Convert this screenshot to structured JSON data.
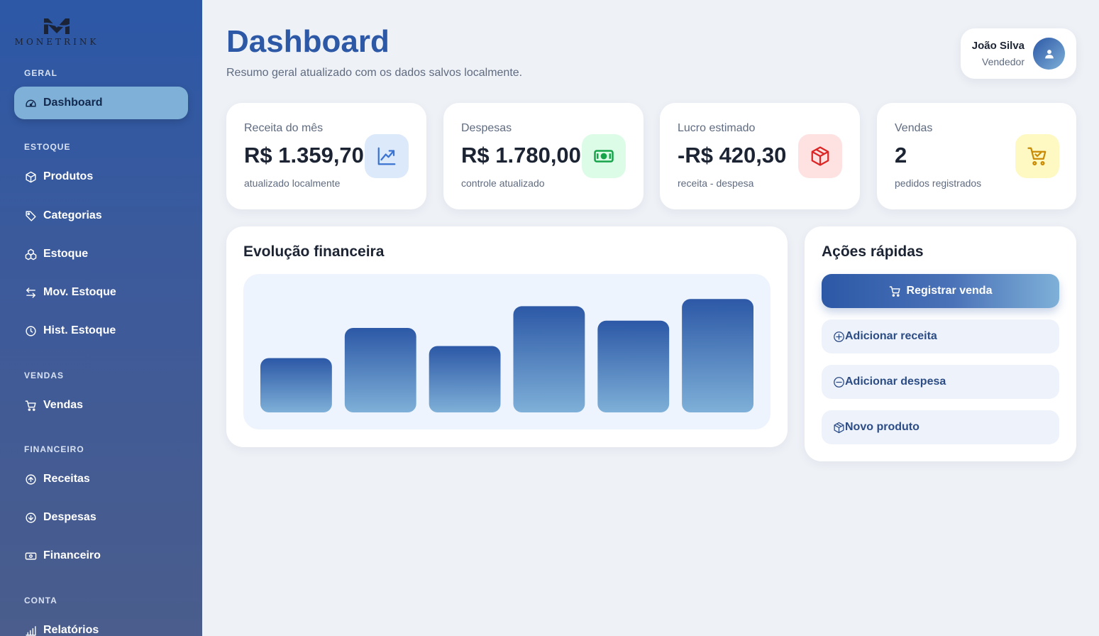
{
  "brand": {
    "name": "MONETRINK"
  },
  "sidebar": {
    "sections": {
      "geral": "GERAL",
      "estoque": "ESTOQUE",
      "vendas": "VENDAS",
      "financeiro": "FINANCEIRO",
      "conta": "CONTA"
    },
    "items": {
      "dashboard": {
        "label": "Dashboard",
        "icon": "gauge-icon",
        "active": true
      },
      "produtos": {
        "label": "Produtos",
        "icon": "box-icon"
      },
      "categorias": {
        "label": "Categorias",
        "icon": "tag-icon"
      },
      "estoque": {
        "label": "Estoque",
        "icon": "boxes-icon"
      },
      "mov_estoque": {
        "label": "Mov. Estoque",
        "icon": "arrows-left-right-icon"
      },
      "hist_estoque": {
        "label": "Hist. Estoque",
        "icon": "clock-icon"
      },
      "vendas": {
        "label": "Vendas",
        "icon": "cart-icon"
      },
      "receitas": {
        "label": "Receitas",
        "icon": "arrow-up-circle-icon"
      },
      "despesas": {
        "label": "Despesas",
        "icon": "arrow-down-circle-icon"
      },
      "financeiro": {
        "label": "Financeiro",
        "icon": "cash-icon"
      },
      "relatorios": {
        "label": "Relatórios",
        "icon": "bar-chart-icon"
      }
    }
  },
  "header": {
    "title": "Dashboard",
    "subtitle": "Resumo geral atualizado com os dados salvos localmente."
  },
  "user": {
    "name": "João Silva",
    "role": "Vendedor",
    "icon": "user-icon"
  },
  "stats": {
    "receita": {
      "label": "Receita do mês",
      "value": "R$ 1.359,70",
      "note": "atualizado localmente",
      "icon": "trend-up-icon",
      "color": "#3b73d1",
      "bg": "#dce9fb"
    },
    "despesas": {
      "label": "Despesas",
      "value": "R$ 1.780,00",
      "note": "controle atualizado",
      "icon": "cash-icon",
      "color": "#17a34a",
      "bg": "#dcfce7"
    },
    "lucro": {
      "label": "Lucro estimado",
      "value": "-R$ 420,30",
      "note": "receita - despesa",
      "icon": "box-icon",
      "color": "#dc2626",
      "bg": "#fee2e2"
    },
    "vendas": {
      "label": "Vendas",
      "value": "2",
      "note": "pedidos registrados",
      "icon": "cart-check-icon",
      "color": "#ca8a04",
      "bg": "#fef9c3"
    }
  },
  "chart_section": {
    "title": "Evolução financeira"
  },
  "chart_data": {
    "type": "bar",
    "values": [
      45,
      70,
      55,
      88,
      76,
      94
    ],
    "ylim": [
      0,
      100
    ],
    "grid": false,
    "colors": {
      "top": "#2c58a6",
      "bottom": "#7eb0d8"
    }
  },
  "quick_actions": {
    "title": "Ações rápidas",
    "items": {
      "registrar_venda": {
        "label": "Registrar venda",
        "icon": "cart-icon"
      },
      "adicionar_receita": {
        "label": "Adicionar receita",
        "icon": "plus-circle-icon"
      },
      "adicionar_despesa": {
        "label": "Adicionar despesa",
        "icon": "minus-circle-icon"
      },
      "novo_produto": {
        "label": "Novo produto",
        "icon": "box-icon"
      }
    }
  }
}
